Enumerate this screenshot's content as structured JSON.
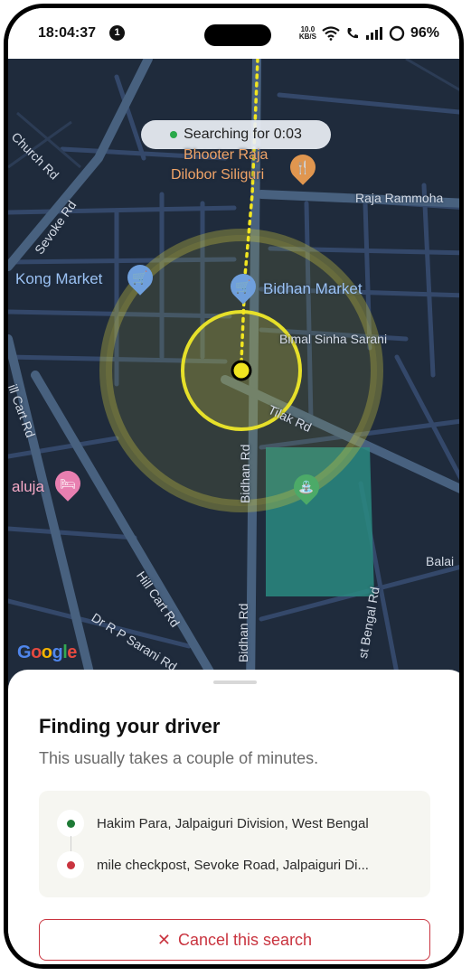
{
  "status_bar": {
    "time": "18:04:37",
    "notification_count": "1",
    "net_speed_value": "10.0",
    "net_speed_unit": "KB/S",
    "battery": "96%"
  },
  "map": {
    "searching_text": "Searching for 0:03",
    "labels": {
      "church_rd": "Church Rd",
      "sevoke_rd": "Sevoke Rd",
      "bhooter_raja_1": "Bhooter Raja",
      "bhooter_raja_2": "Dilobor Siliguri",
      "raja_rammoha": "Raja Rammoha",
      "kong_market": "Kong Market",
      "bidhan_market": "Bidhan Market",
      "bimal_sinha": "Bimal Sinha Sarani",
      "hill_cart_rd_top": "ill Cart Rd",
      "tilak_rd": "Tilak Rd",
      "aluja": "aluja",
      "bidhan_rd_top": "Bidhan Rd",
      "bidhan_rd_bottom": "Bidhan Rd",
      "hill_cart_rd": "Hill Cart Rd",
      "dr_rp_sarani": "Dr R P Sarani Rd",
      "balai": "Balai",
      "sevoke_bengal": "Bengal Rd",
      "sevoke_bengal_2": "st Bengal Rd"
    },
    "google_logo": "Google"
  },
  "sheet": {
    "title": "Finding your driver",
    "subtitle": "This usually takes a couple of minutes.",
    "pickup": "Hakim Para, Jalpaiguri Division, West Bengal",
    "dropoff": "mile checkpost, Sevoke Road, Jalpaiguri Di...",
    "cancel_label": "Cancel this search"
  },
  "colors": {
    "map_bg": "#1f2b3c",
    "road": "#3d5573",
    "pickup_dot": "#1e7a36",
    "dropoff_dot": "#c9343f",
    "accent_red": "#c9343f",
    "search_ring": "#e6e02a"
  }
}
